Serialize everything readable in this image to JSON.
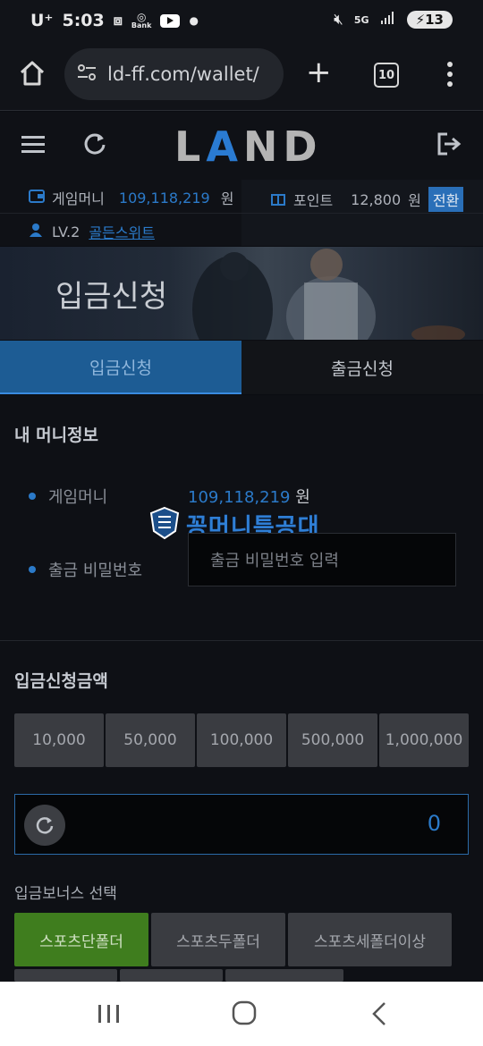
{
  "status_bar": {
    "carrier": "U⁺",
    "time": "5:03",
    "bank_label": "Bank",
    "network": "5G",
    "battery": "13"
  },
  "browser": {
    "url": "ld-ff.com/wallet/",
    "tab_count": "10"
  },
  "header": {
    "logo": "LAND"
  },
  "account": {
    "game_money_label": "게임머니",
    "game_money_value": "109,118,219",
    "currency": "원",
    "point_label": "포인트",
    "point_value": "12,800",
    "point_currency": "원",
    "switch_label": "전환",
    "level": "LV.2",
    "level_name": "골든스위트"
  },
  "banner": {
    "title": "입금신청"
  },
  "tabs": [
    {
      "label": "입금신청",
      "active": true
    },
    {
      "label": "출금신청",
      "active": false
    }
  ],
  "money_info": {
    "title": "내 머니정보",
    "game_money_label": "게임머니",
    "game_money_value": "109,118,219",
    "currency": "원",
    "pw_label": "출금 비밀번호",
    "pw_placeholder": "출금 비밀번호 입력"
  },
  "watermark": {
    "text": "꽁머니특공대"
  },
  "deposit": {
    "title": "입금신청금액",
    "amounts": [
      "10,000",
      "50,000",
      "100,000",
      "500,000",
      "1,000,000"
    ],
    "amount_value": "0"
  },
  "bonus": {
    "title": "입금보너스 선택",
    "options": [
      {
        "label": "스포츠단폴더",
        "selected": true
      },
      {
        "label": "스포츠두폴더",
        "selected": false
      },
      {
        "label": "스포츠세폴더이상",
        "selected": false
      }
    ]
  },
  "colors": {
    "accent": "#2b7ac9",
    "selected_bonus": "#3f7d1e",
    "active_tab": "#1d5c94"
  }
}
